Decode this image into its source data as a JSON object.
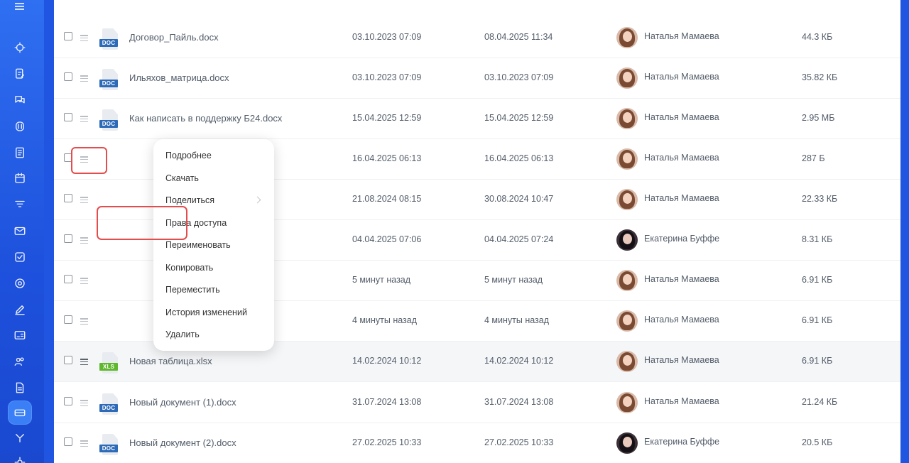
{
  "colors": {
    "sidebar": "#1f55e0",
    "accent_red": "#e34d4d",
    "doc_tag": "#2d6ab8",
    "xls_tag": "#5fb82d"
  },
  "sidebar": {
    "icons": [
      "menu-icon",
      "flows-icon",
      "edit-doc-icon",
      "chat-icon",
      "contact-center-icon",
      "tasks-list-icon",
      "calendar-icon",
      "filter-icon",
      "mail-icon",
      "checkbox-icon",
      "target-icon",
      "pen-icon",
      "id-card-icon",
      "users-icon",
      "document-icon",
      "drive-icon",
      "automation-icon",
      "settings-icon"
    ]
  },
  "files": [
    {
      "name": "Договор_Пайль.docx",
      "type": "DOC",
      "created": "03.10.2023 07:09",
      "modified": "08.04.2025 11:34",
      "owner": "Наталья Мамаева",
      "size": "44.3 КБ",
      "avatar": "light"
    },
    {
      "name": "Ильяхов_матрица.docx",
      "type": "DOC",
      "created": "03.10.2023 07:09",
      "modified": "03.10.2023 07:09",
      "owner": "Наталья Мамаева",
      "size": "35.82 КБ",
      "avatar": "light"
    },
    {
      "name": "Как написать в поддержку Б24.docx",
      "type": "DOC",
      "created": "15.04.2025 12:59",
      "modified": "15.04.2025 12:59",
      "owner": "Наталья Мамаева",
      "size": "2.95 МБ",
      "avatar": "light"
    },
    {
      "name": "",
      "type": "",
      "created": "16.04.2025 06:13",
      "modified": "16.04.2025 06:13",
      "owner": "Наталья Мамаева",
      "size": "287 Б",
      "avatar": "light"
    },
    {
      "name": "",
      "type": "",
      "created": "21.08.2024 08:15",
      "modified": "30.08.2024 10:47",
      "owner": "Наталья Мамаева",
      "size": "22.33 КБ",
      "avatar": "light"
    },
    {
      "name": "",
      "type": "",
      "created": "04.04.2025 07:06",
      "modified": "04.04.2025 07:24",
      "owner": "Екатерина Буффе",
      "size": "8.31 КБ",
      "avatar": "dark"
    },
    {
      "name": "",
      "type": "",
      "created": "5 минут назад",
      "modified": "5 минут назад",
      "owner": "Наталья Мамаева",
      "size": "6.91 КБ",
      "avatar": "light"
    },
    {
      "name": "",
      "type": "",
      "created": "4 минуты назад",
      "modified": "4 минуты назад",
      "owner": "Наталья Мамаева",
      "size": "6.91 КБ",
      "avatar": "light"
    },
    {
      "name": "Новая таблица.xlsx",
      "type": "XLS",
      "created": "14.02.2024 10:12",
      "modified": "14.02.2024 10:12",
      "owner": "Наталья Мамаева",
      "size": "6.91 КБ",
      "avatar": "light"
    },
    {
      "name": "Новый документ (1).docx",
      "type": "DOC",
      "created": "31.07.2024 13:08",
      "modified": "31.07.2024 13:08",
      "owner": "Наталья Мамаева",
      "size": "21.24 КБ",
      "avatar": "light"
    },
    {
      "name": "Новый документ (2).docx",
      "type": "DOC",
      "created": "27.02.2025 10:33",
      "modified": "27.02.2025 10:33",
      "owner": "Екатерина Буффе",
      "size": "20.5 КБ",
      "avatar": "dark"
    }
  ],
  "context_menu": {
    "items": [
      "Подробнее",
      "Скачать",
      "Поделиться",
      "Права доступа",
      "Переименовать",
      "Копировать",
      "Переместить",
      "История изменений",
      "Удалить"
    ]
  }
}
